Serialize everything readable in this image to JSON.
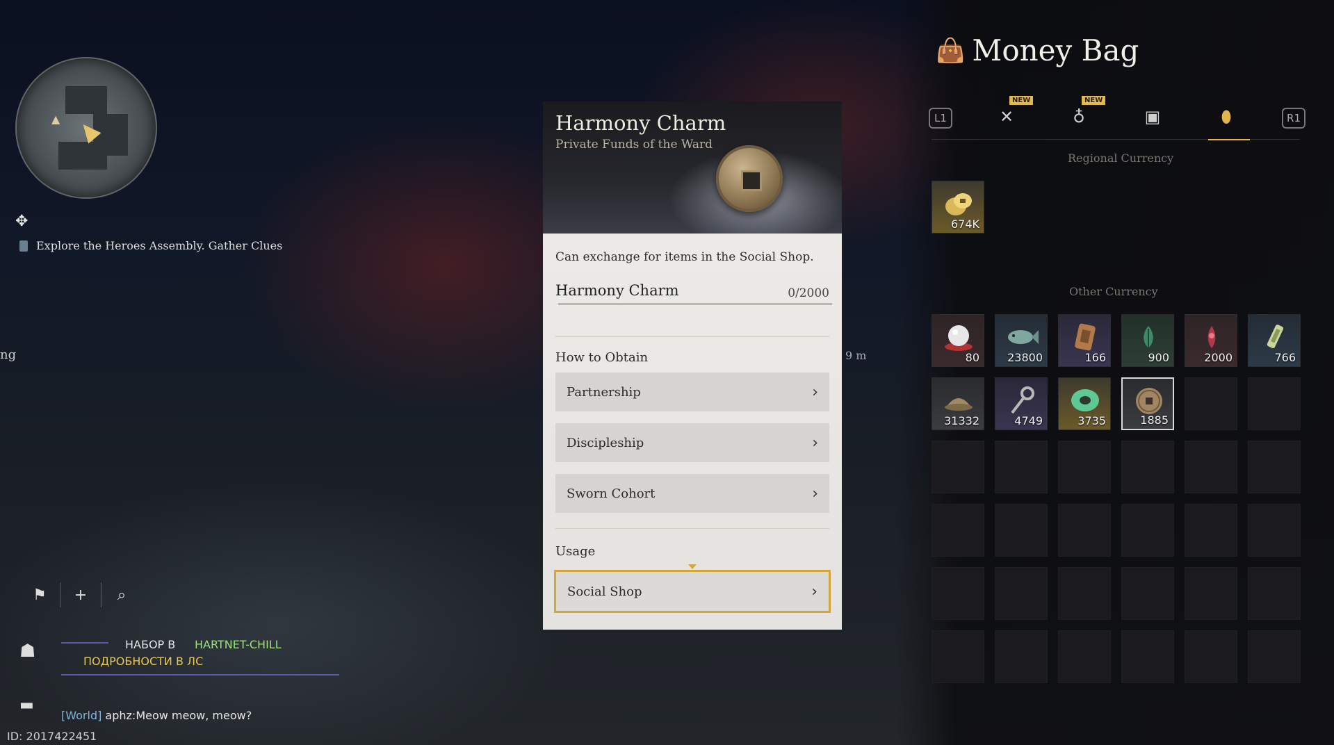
{
  "hud": {
    "quest_text": "Explore the Heroes Assembly. Gather Clues",
    "side_hint": "ng",
    "distance_hint": "9 m",
    "guild_line1_a": "НАБОР В",
    "guild_line1_b": "HARTNET-CHILL",
    "guild_line2": "ПОДРОБНОСТИ В ЛС",
    "chat_channel": "[World]",
    "chat_message": " aphz:Meow meow, meow?",
    "user_id": "ID: 2017422451",
    "tools": [
      "flag-icon",
      "plus-icon",
      "search-icon"
    ]
  },
  "item_card": {
    "title": "Harmony Charm",
    "subtitle": "Private Funds of the Ward",
    "description": "Can exchange for items in the Social Shop.",
    "currency_name": "Harmony Charm",
    "currency_count": "0/2000",
    "progress_fraction": 0,
    "obtain_label": "How to Obtain",
    "obtain_options": [
      "Partnership",
      "Discipleship",
      "Sworn Cohort"
    ],
    "usage_label": "Usage",
    "usage_options": [
      "Social Shop"
    ]
  },
  "money_bag": {
    "title": "Money Bag",
    "tabs": [
      {
        "icon": "l1-key",
        "label": "L1"
      },
      {
        "icon": "crossed-swords-icon",
        "badge": "NEW"
      },
      {
        "icon": "pouch-icon",
        "badge": "NEW"
      },
      {
        "icon": "chest-icon"
      },
      {
        "icon": "location-pin-icon",
        "active": true
      },
      {
        "icon": "r1-key",
        "label": "R1"
      }
    ],
    "regional_label": "Regional Currency",
    "regional_items": [
      {
        "icon": "gold-coins-icon",
        "qty": "674K"
      }
    ],
    "other_label": "Other Currency",
    "other_items": [
      {
        "icon": "pearl-icon",
        "qty": "80"
      },
      {
        "icon": "fish-icon",
        "qty": "23800"
      },
      {
        "icon": "scroll-token-icon",
        "qty": "166"
      },
      {
        "icon": "green-leaf-icon",
        "qty": "900"
      },
      {
        "icon": "red-flower-icon",
        "qty": "2000"
      },
      {
        "icon": "jade-tablet-icon",
        "qty": "766"
      },
      {
        "icon": "ingot-icon",
        "qty": "31332"
      },
      {
        "icon": "key-token-icon",
        "qty": "4749"
      },
      {
        "icon": "jade-ring-icon",
        "qty": "3735"
      },
      {
        "icon": "harmony-charm-icon",
        "qty": "1885",
        "selected": true
      }
    ]
  }
}
